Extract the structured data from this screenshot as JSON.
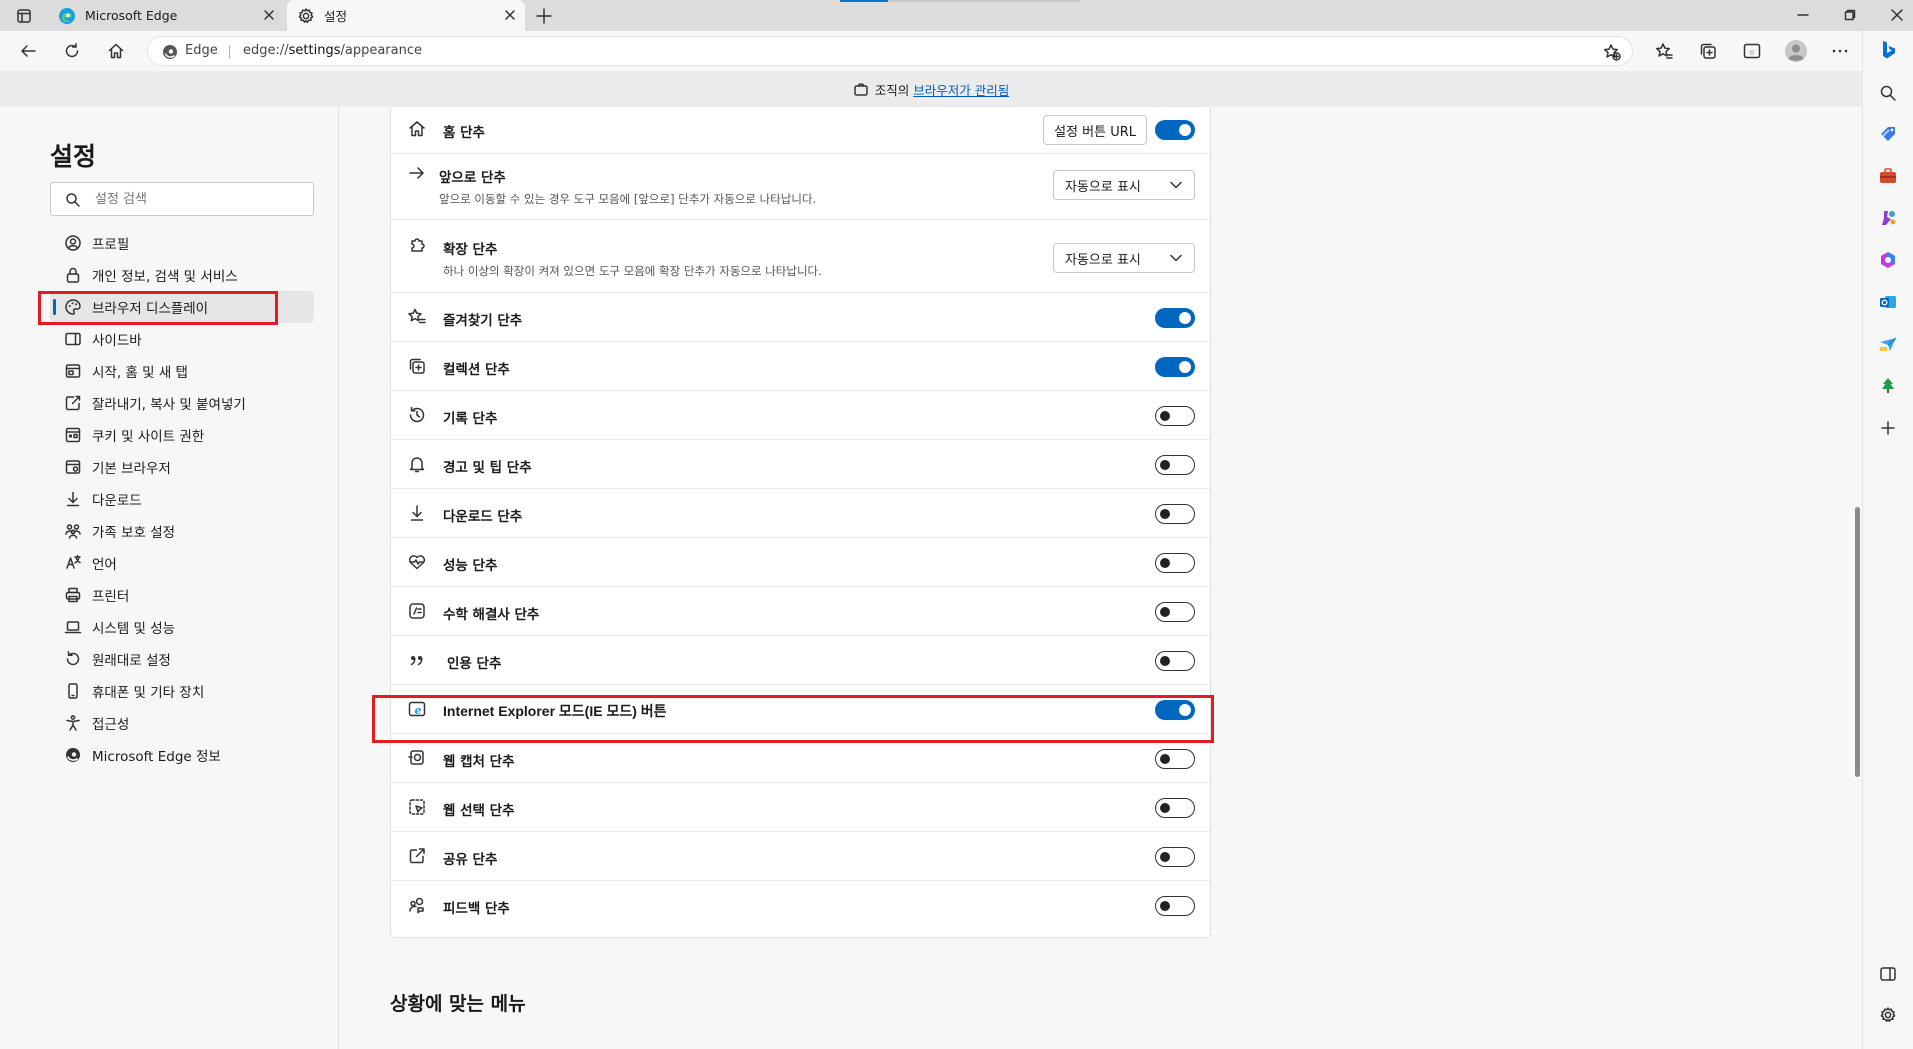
{
  "tabs": [
    {
      "title": "Microsoft Edge"
    },
    {
      "title": "설정"
    }
  ],
  "address": {
    "site": "Edge",
    "url_prefix": "edge://",
    "url_host": "settings",
    "url_path": "/appearance"
  },
  "managed_bar": {
    "prefix": "조직의 ",
    "link": "브라우저가 관리됨"
  },
  "nav": {
    "title": "설정",
    "search_placeholder": "설정 검색",
    "items": [
      {
        "label": "프로필",
        "icon": "profile-icon"
      },
      {
        "label": "개인 정보, 검색 및 서비스",
        "icon": "lock-icon"
      },
      {
        "label": "브라우저 디스플레이",
        "icon": "palette-icon",
        "active": true
      },
      {
        "label": "사이드바",
        "icon": "sidebar-icon"
      },
      {
        "label": "시작, 홈 및 새 탭",
        "icon": "home-tab-icon"
      },
      {
        "label": "잘라내기, 복사 및 붙여넣기",
        "icon": "share-icon"
      },
      {
        "label": "쿠키 및 사이트 권한",
        "icon": "cookie-icon"
      },
      {
        "label": "기본 브라우저",
        "icon": "browser-icon"
      },
      {
        "label": "다운로드",
        "icon": "download-icon"
      },
      {
        "label": "가족 보호 설정",
        "icon": "family-icon"
      },
      {
        "label": "언어",
        "icon": "language-icon"
      },
      {
        "label": "프린터",
        "icon": "printer-icon"
      },
      {
        "label": "시스템 및 성능",
        "icon": "laptop-icon"
      },
      {
        "label": "원래대로 설정",
        "icon": "reset-icon"
      },
      {
        "label": "휴대폰 및 기타 장치",
        "icon": "phone-icon"
      },
      {
        "label": "접근성",
        "icon": "accessibility-icon"
      },
      {
        "label": "Microsoft Edge 정보",
        "icon": "edge-icon"
      }
    ]
  },
  "settings": {
    "home": {
      "label": "홈 단추",
      "button": "설정 버튼 URL",
      "on": true
    },
    "forward": {
      "label": "앞으로 단추",
      "desc": "앞으로 이동할 수 있는 경우 도구 모음에 [앞으로] 단추가 자동으로 나타납니다.",
      "dropdown": "자동으로 표시"
    },
    "extensions": {
      "label": "확장 단추",
      "desc": "하나 이상의 확장이 켜져 있으면 도구 모음에 확장 단추가 자동으로 나타납니다.",
      "dropdown": "자동으로 표시"
    },
    "favorites": {
      "label": "즐겨찾기 단추",
      "on": true
    },
    "collections": {
      "label": "컬렉션 단추",
      "on": true
    },
    "history": {
      "label": "기록 단추",
      "on": false
    },
    "alerts": {
      "label": "경고 및 팁 단추",
      "on": false
    },
    "downloads": {
      "label": "다운로드 단추",
      "on": false
    },
    "performance": {
      "label": "성능 단추",
      "on": false
    },
    "math": {
      "label": "수학 해결사 단추",
      "on": false
    },
    "citations": {
      "label": "인용 단추",
      "on": false
    },
    "iemode": {
      "label": "Internet Explorer 모드(IE 모드) 버튼",
      "on": true
    },
    "webcapture": {
      "label": "웹 캡처 단추",
      "on": false
    },
    "webselect": {
      "label": "웹 선택 단추",
      "on": false
    },
    "share": {
      "label": "공유 단추",
      "on": false
    },
    "feedback": {
      "label": "피드백 단추",
      "on": false
    }
  },
  "section_next": "상황에 맞는 메뉴",
  "colors": {
    "accent": "#0067c0",
    "highlight": "#e31b23"
  }
}
